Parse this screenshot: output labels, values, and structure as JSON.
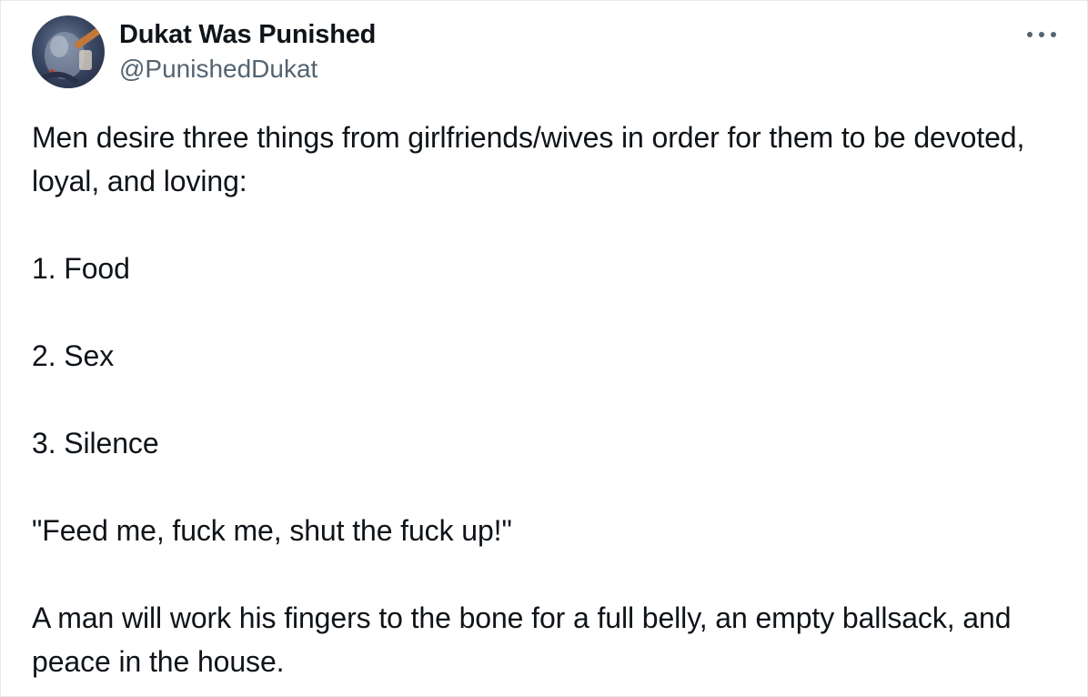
{
  "author": {
    "display_name": "Dukat Was Punished",
    "handle": "@PunishedDukat",
    "avatar_icon": "profile-avatar"
  },
  "more_icon": "more-options-icon",
  "tweet": {
    "paragraphs": [
      "Men desire three things from girlfriends/wives in order for them to be devoted, loyal, and loving:",
      "1. Food",
      "2. Sex",
      "3. Silence",
      "\"Feed me, fuck me, shut the fuck up!\"",
      "A man will work his fingers to the bone for a full belly, an empty ballsack, and peace in the house."
    ]
  },
  "colors": {
    "text": "#0f1419",
    "secondary_text": "#536471",
    "background": "#ffffff"
  }
}
